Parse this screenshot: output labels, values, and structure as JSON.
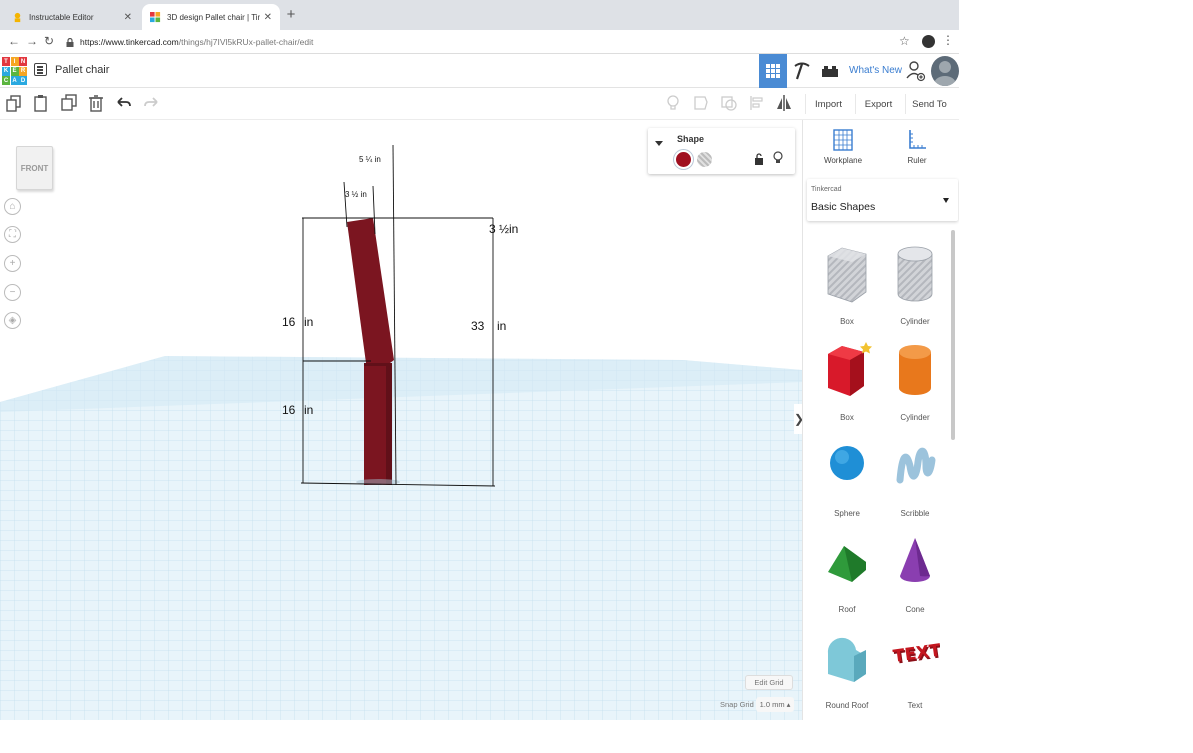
{
  "browser": {
    "tabs": [
      {
        "title": "Instructable Editor",
        "active": false
      },
      {
        "title": "3D design Pallet chair | Tinker",
        "active": true
      }
    ],
    "url_domain": "https://www.tinkercad.com",
    "url_path": "/things/hj7IVl5kRUx-pallet-chair/edit"
  },
  "header": {
    "logo_letters": [
      "T",
      "I",
      "N",
      "K",
      "E",
      "R",
      "C",
      "A",
      "D"
    ],
    "design_title": "Pallet chair",
    "whats_new": "What's New"
  },
  "toolbar": {
    "import": "Import",
    "export": "Export",
    "send_to": "Send To"
  },
  "viewport": {
    "viewcube_label": "FRONT",
    "dimensions": {
      "top_width": "5 ¼  in",
      "back_width": "3 ½ in",
      "side_width": "3 ½in",
      "upper_height_num": "16",
      "upper_height_unit": "in",
      "lower_height_num": "16",
      "lower_height_unit": "in",
      "total_height_num": "33",
      "total_height_unit": "in"
    },
    "edit_grid": "Edit Grid",
    "snap_grid_label": "Snap Grid",
    "snap_grid_value": "1.0 mm",
    "shape_color": "#7b1520",
    "grid_color": "#cfe6f2"
  },
  "inspector": {
    "label": "Shape",
    "solid_color": "#a01020"
  },
  "panel": {
    "workplane": "Workplane",
    "ruler": "Ruler",
    "library_small": "Tinkercad",
    "library_name": "Basic Shapes",
    "shapes": [
      {
        "name": "Box",
        "icon": "box-hole-icon"
      },
      {
        "name": "Cylinder",
        "icon": "cylinder-hole-icon"
      },
      {
        "name": "Box",
        "icon": "box-icon"
      },
      {
        "name": "Cylinder",
        "icon": "cylinder-icon"
      },
      {
        "name": "Sphere",
        "icon": "sphere-icon"
      },
      {
        "name": "Scribble",
        "icon": "scribble-icon"
      },
      {
        "name": "Roof",
        "icon": "roof-icon"
      },
      {
        "name": "Cone",
        "icon": "cone-icon"
      },
      {
        "name": "Round Roof",
        "icon": "round-roof-icon"
      },
      {
        "name": "Text",
        "icon": "text-icon"
      }
    ],
    "colors": {
      "box": "#d8192a",
      "cylinder": "#e8781c",
      "sphere": "#1f8fd6",
      "roof": "#2f9a3b",
      "cone": "#8a3eb0",
      "round_roof": "#7ec8d8",
      "text": "#c4161f"
    }
  }
}
